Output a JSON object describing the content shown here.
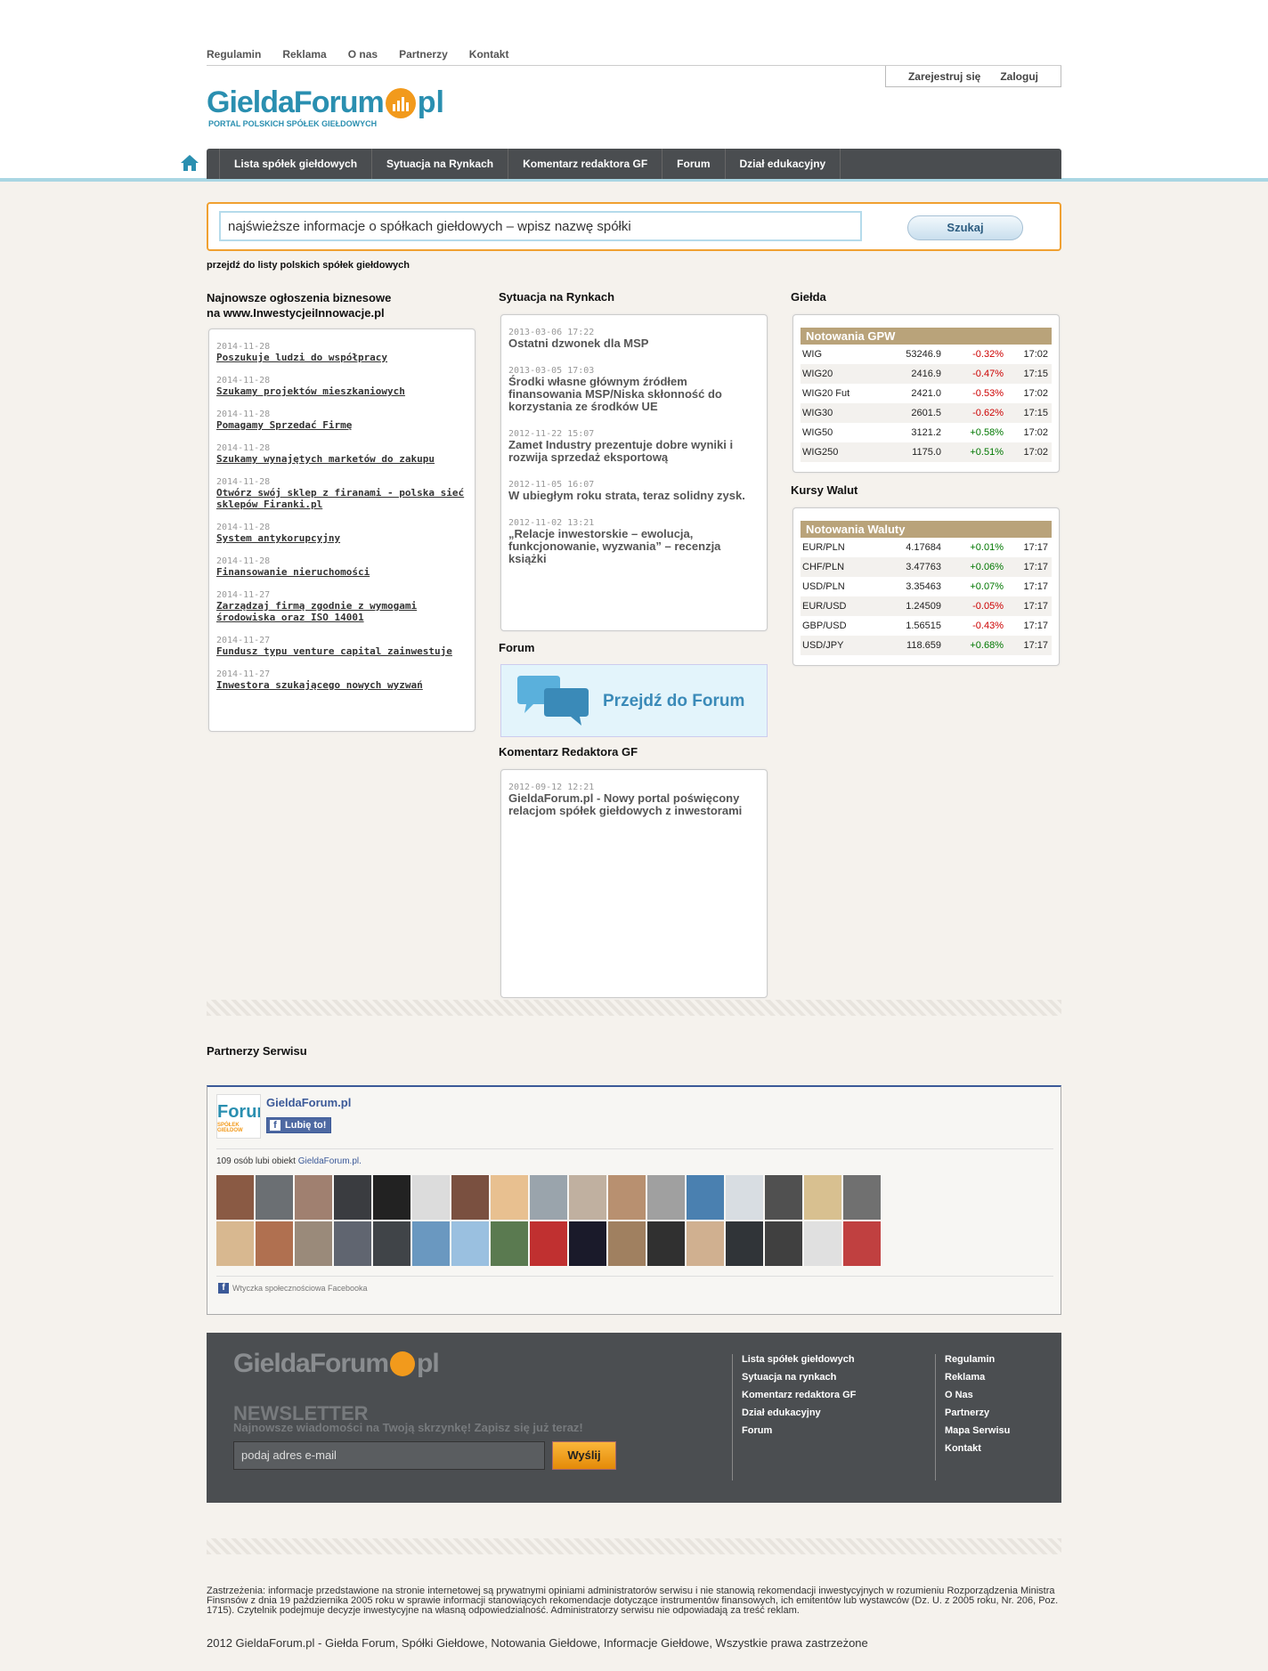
{
  "topnav": [
    "Regulamin",
    "Reklama",
    "O nas",
    "Partnerzy",
    "Kontakt"
  ],
  "auth": {
    "register": "Zarejestruj się",
    "login": "Zaloguj"
  },
  "logo": {
    "name": "GieldaForum",
    "tld": "pl",
    "tagline": "PORTAL POLSKICH SPÓŁEK GIEŁDOWYCH"
  },
  "mainnav": [
    "Lista spółek giełdowych",
    "Sytuacja na Rynkach",
    "Komentarz redaktora GF",
    "Forum",
    "Dział edukacyjny"
  ],
  "search": {
    "value": "najświeższe informacje o spółkach giełdowych – wpisz nazwę spółki",
    "button": "Szukaj"
  },
  "listlink": "przejdź do listy polskich spółek giełdowych",
  "ann": {
    "heading1": "Najnowsze ogłoszenia biznesowe",
    "heading2": "na www.InwestycjeiInnowacje.pl",
    "items": [
      {
        "date": "2014-11-28",
        "title": "Poszukuje ludzi do współpracy"
      },
      {
        "date": "2014-11-28",
        "title": "Szukamy projektów mieszkaniowych"
      },
      {
        "date": "2014-11-28",
        "title": "Pomagamy Sprzedać Firmę"
      },
      {
        "date": "2014-11-28",
        "title": "Szukamy wynajętych marketów do zakupu"
      },
      {
        "date": "2014-11-28",
        "title": "Otwórz swój sklep z firanami - polska sieć sklepów Firanki.pl"
      },
      {
        "date": "2014-11-28",
        "title": "System antykorupcyjny"
      },
      {
        "date": "2014-11-28",
        "title": "Finansowanie nieruchomości"
      },
      {
        "date": "2014-11-27",
        "title": "Zarządzaj firmą zgodnie z wymogami środowiska oraz ISO 14001"
      },
      {
        "date": "2014-11-27",
        "title": "Fundusz typu venture capital zainwestuje"
      },
      {
        "date": "2014-11-27",
        "title": "Inwestora szukającego nowych wyzwań"
      }
    ]
  },
  "market": {
    "heading": "Sytuacja na Rynkach",
    "items": [
      {
        "date": "2013-03-06 17:22",
        "title": "Ostatni dzwonek dla MSP"
      },
      {
        "date": "2013-03-05 17:03",
        "title": "Środki własne głównym źródłem finansowania MSP/Niska skłonność do korzystania ze środków UE"
      },
      {
        "date": "2012-11-22 15:07",
        "title": "Zamet Industry prezentuje dobre wyniki i rozwija sprzedaż eksportową"
      },
      {
        "date": "2012-11-05 16:07",
        "title": "W ubiegłym roku strata, teraz solidny zysk."
      },
      {
        "date": "2012-11-02 13:21",
        "title": "„Relacje inwestorskie – ewolucja, funkcjonowanie, wyzwania” – recenzja książki"
      }
    ]
  },
  "forum": {
    "heading": "Forum",
    "banner": "Przejdź do Forum"
  },
  "comment": {
    "heading": "Komentarz Redaktora GF",
    "date": "2012-09-12 12:21",
    "title": "GieldaForum.pl - Nowy portal poświęcony relacjom spółek giełdowych z inwestorami"
  },
  "gielda": {
    "heading": "Giełda",
    "title": "Notowania GPW",
    "rows": [
      {
        "name": "WIG",
        "value": "53246.9",
        "change": "-0.32%",
        "time": "17:02",
        "dir": "neg"
      },
      {
        "name": "WIG20",
        "value": "2416.9",
        "change": "-0.47%",
        "time": "17:15",
        "dir": "neg"
      },
      {
        "name": "WIG20 Fut",
        "value": "2421.0",
        "change": "-0.53%",
        "time": "17:02",
        "dir": "neg"
      },
      {
        "name": "WIG30",
        "value": "2601.5",
        "change": "-0.62%",
        "time": "17:15",
        "dir": "neg"
      },
      {
        "name": "WIG50",
        "value": "3121.2",
        "change": "+0.58%",
        "time": "17:02",
        "dir": "pos"
      },
      {
        "name": "WIG250",
        "value": "1175.0",
        "change": "+0.51%",
        "time": "17:02",
        "dir": "pos"
      }
    ]
  },
  "waluty": {
    "heading": "Kursy Walut",
    "title": "Notowania Waluty",
    "rows": [
      {
        "name": "EUR/PLN",
        "value": "4.17684",
        "change": "+0.01%",
        "time": "17:17",
        "dir": "pos"
      },
      {
        "name": "CHF/PLN",
        "value": "3.47763",
        "change": "+0.06%",
        "time": "17:17",
        "dir": "pos"
      },
      {
        "name": "USD/PLN",
        "value": "3.35463",
        "change": "+0.07%",
        "time": "17:17",
        "dir": "pos"
      },
      {
        "name": "EUR/USD",
        "value": "1.24509",
        "change": "-0.05%",
        "time": "17:17",
        "dir": "neg"
      },
      {
        "name": "GBP/USD",
        "value": "1.56515",
        "change": "-0.43%",
        "time": "17:17",
        "dir": "neg"
      },
      {
        "name": "USD/JPY",
        "value": "118.659",
        "change": "+0.68%",
        "time": "17:17",
        "dir": "pos"
      }
    ]
  },
  "partners": {
    "heading": "Partnerzy Serwisu"
  },
  "fb": {
    "page": "GieldaForum.pl",
    "like": "Lubię to!",
    "count": "109 osób lubi obiekt",
    "countlink": "GieldaForum.pl.",
    "plugin": "Wtyczka społecznościowa Facebooka",
    "logotext": "Forum",
    "logosub": "SPÓŁEK GIEŁDOW"
  },
  "footer": {
    "newsletter": "NEWSLETTER",
    "sub": "Najnowsze wiadomości na Twoją skrzynkę! Zapisz się już teraz!",
    "placeholder": "podaj adres e-mail",
    "send": "Wyślij",
    "col1": [
      "Lista spółek giełdowych",
      "Sytuacja na rynkach",
      "Komentarz redaktora GF",
      "Dział edukacyjny",
      "Forum"
    ],
    "col2": [
      "Regulamin",
      "Reklama",
      "O Nas",
      "Partnerzy",
      "Mapa Serwisu",
      "Kontakt"
    ]
  },
  "disclaimer": "Zastrzeżenia: informacje przedstawione na stronie internetowej są prywatnymi opiniami administratorów serwisu i nie stanowią rekomendacji inwestycyjnych w rozumieniu Rozporządzenia Ministra Finsnsów z dnia 19 października 2005 roku w sprawie informacji stanowiących rekomendacje dotyczące instrumentów finansowych, ich emitentów lub wystawców (Dz. U. z 2005 roku, Nr. 206, Poz. 1715). Czytelnik podejmuje decyzje inwestycyjne na własną odpowiedzialność. Administratorzy serwisu nie odpowiadają za treść reklam.",
  "copyright": "2012 GieldaForum.pl - Giełda Forum, Spółki Giełdowe, Notowania Giełdowe, Informacje Giełdowe, Wszystkie prawa zastrzeżone",
  "colors": {
    "accent": "#f0a030",
    "brand": "#2a8fb0",
    "nav": "#4a4d50",
    "quoteHeader": "#b9a37a"
  }
}
